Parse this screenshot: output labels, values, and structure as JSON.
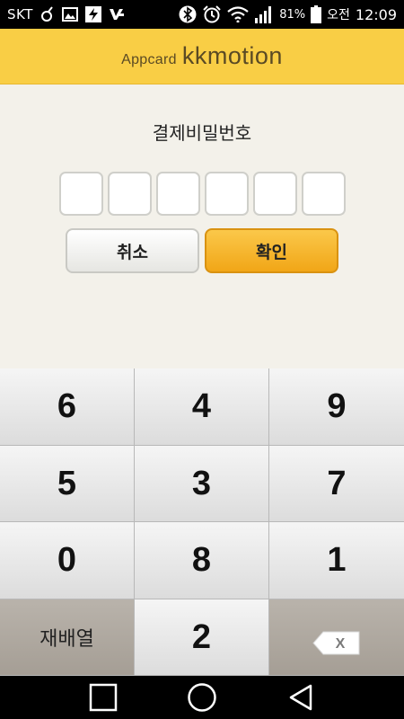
{
  "status_bar": {
    "carrier": "SKT",
    "battery_percent": "81%",
    "clock_prefix": "오전",
    "clock": "12:09",
    "icons": [
      "pokemon-icon",
      "image-icon",
      "flash-icon",
      "v3-icon",
      "bluetooth-icon",
      "alarm-icon",
      "wifi-icon",
      "signal-icon",
      "battery-icon"
    ]
  },
  "header": {
    "brand_small": "Appcard",
    "brand_big": "kkmotion"
  },
  "panel": {
    "title": "결제비밀번호",
    "pin_length": 6,
    "cancel_label": "취소",
    "confirm_label": "확인"
  },
  "keypad": {
    "keys": [
      "6",
      "4",
      "9",
      "5",
      "3",
      "7",
      "0",
      "8",
      "1"
    ],
    "shuffle_label": "재배열",
    "bottom_center_key": "2",
    "backspace_label": "X"
  },
  "colors": {
    "header_yellow": "#f9ce45",
    "confirm_orange": "#f1a617",
    "background": "#f3f1ea"
  }
}
